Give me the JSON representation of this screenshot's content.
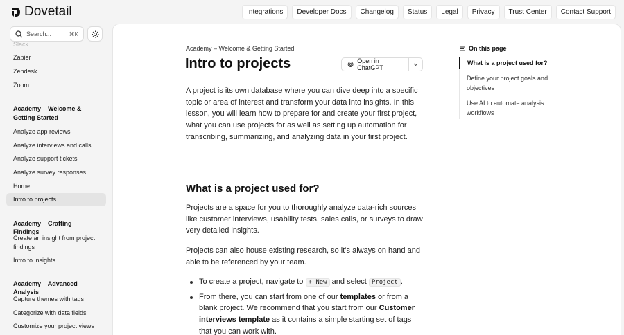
{
  "brand": {
    "name": "Dovetail"
  },
  "topnav": [
    "Integrations",
    "Developer Docs",
    "Changelog",
    "Status",
    "Legal",
    "Privacy",
    "Trust Center",
    "Contact Support"
  ],
  "search": {
    "placeholder": "Search...",
    "shortcut": "⌘K"
  },
  "sidebar": {
    "items_top": [
      "Slack",
      "Zapier",
      "Zendesk",
      "Zoom"
    ],
    "groups": [
      {
        "title": "Academy – Welcome & Getting Started",
        "items": [
          "Analyze app reviews",
          "Analyze interviews and calls",
          "Analyze support tickets",
          "Analyze survey responses",
          "Home",
          "Intro to projects"
        ]
      },
      {
        "title": "Academy – Crafting Findings",
        "items": [
          "Create an insight from project findings",
          "Intro to insights"
        ]
      },
      {
        "title": "Academy – Advanced Analysis",
        "items": [
          "Capture themes with tags",
          "Categorize with data fields",
          "Customize your project views"
        ]
      }
    ]
  },
  "article": {
    "breadcrumb": "Academy – Welcome & Getting Started",
    "title": "Intro to projects",
    "open_chatgpt": "Open in ChatGPT",
    "intro": "A project is its own database where you can dive deep into a specific topic or area of interest and transform your data into insights. In this lesson, you will learn how to prepare for and create your first project, what you can use projects for as well as setting up automation for transcribing, summarizing, and analyzing data in your first project.",
    "h2": "What is a project used for?",
    "p1": "Projects are a space for you to thoroughly analyze data-rich sources like customer interviews, usability tests, sales calls, or surveys to draw very detailed insights.",
    "p2": "Projects can also house existing research, so it’s always on hand and able to be referenced by your team.",
    "b1_pre": "To create a project, navigate to",
    "b1_code1": "+ New",
    "b1_mid": "and select",
    "b1_code2": "Project",
    "b1_post": ".",
    "b2_pre": "From there, you can start from one of our",
    "b2_link1": "templates",
    "b2_mid": "or from a blank project. We recommend that you start from our",
    "b2_link2": "Customer interviews template",
    "b2_post": "as it contains a simple starting set of tags that you can work with."
  },
  "toc": {
    "title": "On this page",
    "items": [
      "What is a project used for?",
      "Define your project goals and objectives",
      "Use AI to automate analysis workflows"
    ]
  }
}
